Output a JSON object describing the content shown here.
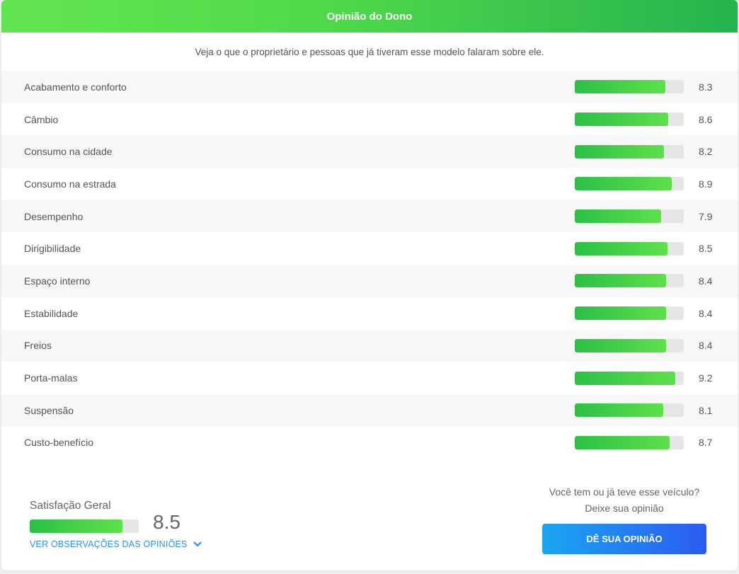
{
  "header": {
    "title": "Opinião do Dono"
  },
  "subtitle": "Veja o que o proprietário e pessoas que já tiveram esse modelo falaram sobre ele.",
  "ratings": [
    {
      "label": "Acabamento e conforto",
      "value": "8.3"
    },
    {
      "label": "Câmbio",
      "value": "8.6"
    },
    {
      "label": "Consumo na cidade",
      "value": "8.2"
    },
    {
      "label": "Consumo na estrada",
      "value": "8.9"
    },
    {
      "label": "Desempenho",
      "value": "7.9"
    },
    {
      "label": "Dirigibilidade",
      "value": "8.5"
    },
    {
      "label": "Espaço interno",
      "value": "8.4"
    },
    {
      "label": "Estabilidade",
      "value": "8.4"
    },
    {
      "label": "Freios",
      "value": "8.4"
    },
    {
      "label": "Porta-malas",
      "value": "9.2"
    },
    {
      "label": "Suspensão",
      "value": "8.1"
    },
    {
      "label": "Custo-benefício",
      "value": "8.7"
    }
  ],
  "rating_scale_max": 10,
  "overall": {
    "label": "Satisfação Geral",
    "value": "8.5",
    "see_more": "VER OBSERVAÇÕES DAS OPINIÕES"
  },
  "cta": {
    "line1": "Você tem ou já teve esse veículo?",
    "line2": "Deixe sua opinião",
    "button": "DÊ SUA OPINIÃO"
  },
  "colors": {
    "header_gradient": [
      "#63e552",
      "#26b34e"
    ],
    "bar_gradient": [
      "#2cc046",
      "#5ee04b"
    ],
    "button_gradient": [
      "#1aa6f2",
      "#2c5bf0"
    ],
    "link": "#2a8ff0"
  },
  "icons": {
    "see_more": "chevron-down-icon"
  }
}
